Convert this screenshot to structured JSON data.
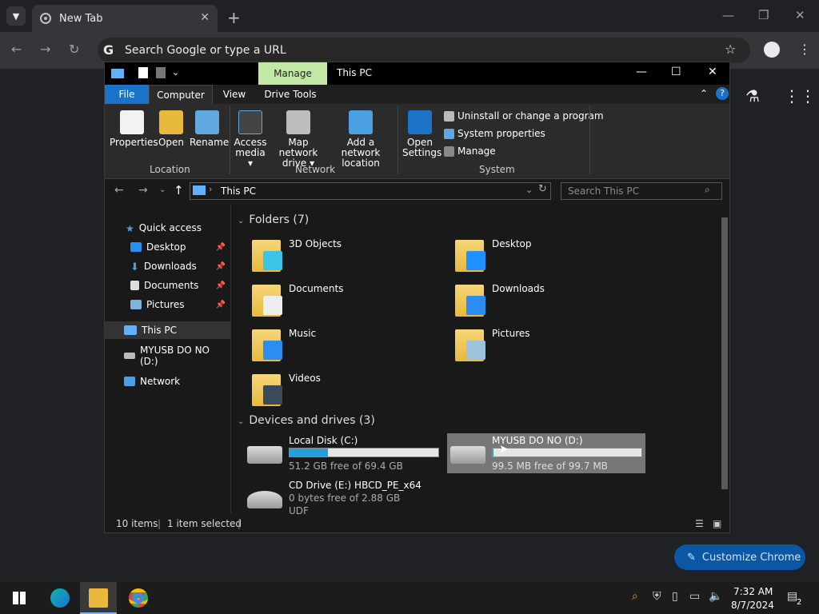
{
  "chrome": {
    "tab_title": "New Tab",
    "omnibox_placeholder": "Search Google or type a URL",
    "g_letter": "G",
    "customize_label": "Customize Chrome"
  },
  "explorer": {
    "title": "This PC",
    "contextual_tab": "Manage",
    "tabs": [
      "File",
      "Computer",
      "View",
      "Drive Tools"
    ],
    "ribbon": {
      "location": {
        "label": "Location",
        "buttons": [
          "Properties",
          "Open",
          "Rename"
        ]
      },
      "network": {
        "label": "Network",
        "buttons": [
          [
            "Access",
            "media ▾"
          ],
          [
            "Map network",
            "drive ▾"
          ],
          [
            "Add a network",
            "location"
          ]
        ]
      },
      "system": {
        "label": "System",
        "open_settings": [
          "Open",
          "Settings"
        ],
        "items": [
          "Uninstall or change a program",
          "System properties",
          "Manage"
        ]
      }
    },
    "address": "This PC",
    "search_placeholder": "Search This PC",
    "nav": {
      "quick_access": "Quick access",
      "pinned": [
        "Desktop",
        "Downloads",
        "Documents",
        "Pictures"
      ],
      "this_pc": "This PC",
      "usb": "MYUSB DO NO (D:)",
      "network": "Network"
    },
    "folders_title": "Folders (7)",
    "folders": [
      "3D Objects",
      "Desktop",
      "Documents",
      "Downloads",
      "Music",
      "Pictures",
      "Videos"
    ],
    "devices_title": "Devices and drives (3)",
    "drives": [
      {
        "name": "Local Disk (C:)",
        "free": "51.2 GB free of 69.4 GB",
        "used_fraction": 0.26
      },
      {
        "name": "MYUSB DO NO (D:)",
        "free": "99.5 MB free of 99.7 MB",
        "used_fraction": 0.002
      },
      {
        "name": "CD Drive (E:) HBCD_PE_x64",
        "free": "0 bytes free of 2.88 GB",
        "extra": "UDF"
      }
    ],
    "status": {
      "items": "10 items",
      "selected": "1 item selected"
    }
  },
  "taskbar": {
    "time": "7:32 AM",
    "date": "8/7/2024",
    "notif_count": "2"
  },
  "colors": {
    "accent": "#1a73c8",
    "manage_tab": "#c3e8a6",
    "bar_fill": "#26a0da",
    "chrome_button": "#0b57a4"
  }
}
